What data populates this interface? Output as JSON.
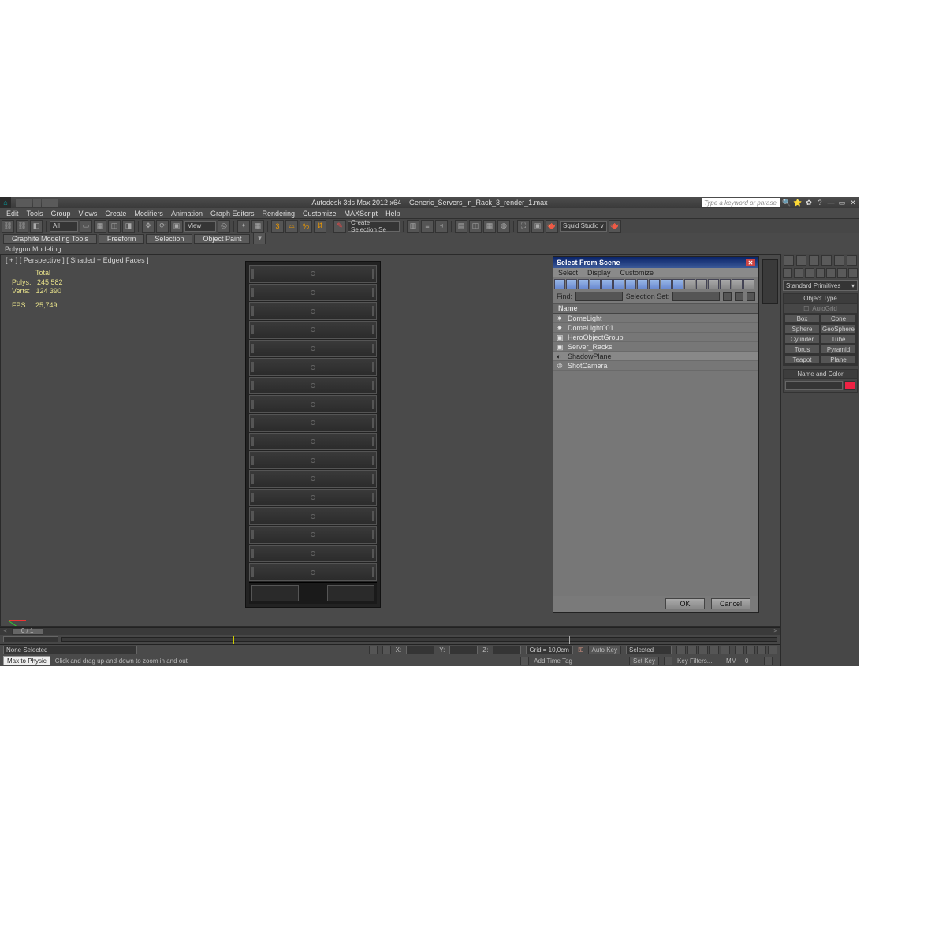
{
  "title": {
    "app": "Autodesk 3ds Max 2012 x64",
    "file": "Generic_Servers_in_Rack_3_render_1.max",
    "search_placeholder": "Type a keyword or phrase"
  },
  "menus": [
    "Edit",
    "Tools",
    "Group",
    "Views",
    "Create",
    "Modifiers",
    "Animation",
    "Graph Editors",
    "Rendering",
    "Customize",
    "MAXScript",
    "Help"
  ],
  "toolbar": {
    "selection_filter": "All",
    "view_dd": "View",
    "create_sel": "Create Selection Se",
    "render_dd": "Squid Studio v"
  },
  "ribbon": {
    "tabs": [
      "Graphite Modeling Tools",
      "Freeform",
      "Selection",
      "Object Paint"
    ],
    "subtab": "Polygon Modeling"
  },
  "viewport": {
    "label": "[ + ] [ Perspective ] [ Shaded + Edged Faces ]",
    "stats": {
      "head": "Total",
      "polys_l": "Polys:",
      "polys_v": "245 582",
      "verts_l": "Verts:",
      "verts_v": "124 390",
      "fps_l": "FPS:",
      "fps_v": "25,749"
    }
  },
  "dialog": {
    "title": "Select From Scene",
    "menus": [
      "Select",
      "Display",
      "Customize"
    ],
    "find_l": "Find:",
    "selset_l": "Selection Set:",
    "header": "Name",
    "rows": [
      "DomeLight",
      "DomeLight001",
      "HeroObjectGroup",
      "Server_Racks",
      "ShadowPlane",
      "ShotCamera"
    ],
    "selected_index": 4,
    "ok": "OK",
    "cancel": "Cancel"
  },
  "cmdpanel": {
    "drop": "Standard Primitives",
    "objtype": "Object Type",
    "autogrid": "AutoGrid",
    "buttons": [
      "Box",
      "Cone",
      "Sphere",
      "GeoSphere",
      "Cylinder",
      "Tube",
      "Torus",
      "Pyramid",
      "Teapot",
      "Plane"
    ],
    "namecolor": "Name and Color"
  },
  "status": {
    "none": "None Selected",
    "hint": "Click and drag up-and-down to zoom in and out",
    "xl": "X:",
    "yl": "Y:",
    "zl": "Z:",
    "grid": "Grid = 10,0cm",
    "autokey": "Auto Key",
    "setkey": "Set Key",
    "selected": "Selected",
    "keyfilters": "Key Filters...",
    "addtag": "Add Time Tag",
    "m2p": "Max to Physic",
    "frame": "0 / 1",
    "mmm": "MM",
    "zero": "0"
  }
}
